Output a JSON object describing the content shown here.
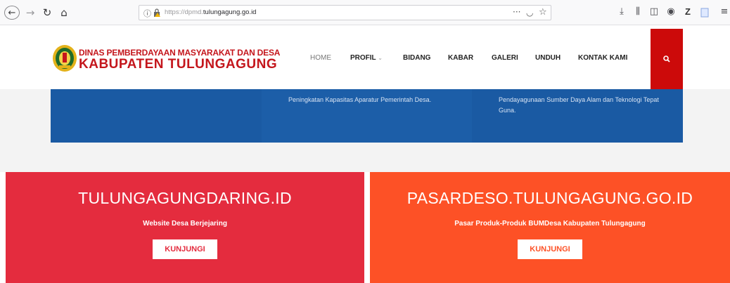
{
  "browser": {
    "url_prefix": "https://dpmd.",
    "url_domain": "tulungagung.go.id",
    "icons": {
      "back": "back-arrow-icon",
      "forward": "forward-arrow-icon",
      "reload": "reload-icon",
      "home": "home-icon",
      "info": "info-icon",
      "lock": "lock-warning-icon",
      "more": "more-dots-icon",
      "pocket": "pocket-icon",
      "bookmark": "star-icon",
      "downloads": "download-icon",
      "library": "library-icon",
      "sidebar": "sidebar-icon",
      "account": "account-icon",
      "zotero": "zotero-icon",
      "extension": "extension-icon",
      "menu": "hamburger-menu-icon"
    }
  },
  "header": {
    "org_line1": "DINAS PEMBERDAYAAN MASYARAKAT DAN DESA",
    "org_line2": "KABUPATEN TULUNGAGUNG",
    "logo": "regency-emblem-logo",
    "nav": {
      "home": "HOME",
      "profil": "PROFIL",
      "bidang": "BIDANG",
      "kabar": "KABAR",
      "galeri": "GALERI",
      "unduh": "UNDUH",
      "kontak": "KONTAK KAMI"
    },
    "search_icon": "search-icon",
    "colors": {
      "brand_red": "#c4161c",
      "search_bg": "#cc0a0a"
    }
  },
  "services": {
    "items": [
      {
        "text": "Peningkatan Kapasitas Aparatur Pemerintah Desa."
      },
      {
        "text": "Pendayagunaan Sumber Daya Alam dan Teknologi Tepat Guna."
      }
    ],
    "colors": {
      "band": "#1a5aa3"
    }
  },
  "cards": [
    {
      "title": "TULUNGAGUNGDARING.ID",
      "subtitle": "Website Desa Berjejaring",
      "button": "KUNJUNGI",
      "color": "#e42c3e"
    },
    {
      "title": "PASARDESO.TULUNGAGUNG.GO.ID",
      "subtitle": "Pasar Produk-Produk BUMDesa Kabupaten Tulungagung",
      "button": "KUNJUNGI",
      "color": "#fd5126"
    }
  ]
}
